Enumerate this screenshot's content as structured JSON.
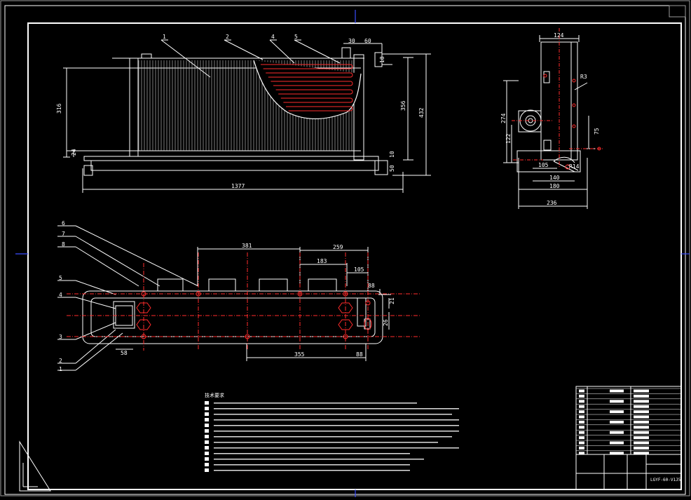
{
  "colors": {
    "background": "#000000",
    "frame": "#ffffff",
    "center_mark": "#3a4cff",
    "red": "#ff2b2b",
    "tile_white": "#ffffff",
    "gray_frame": "#9a9a9a"
  },
  "front_view": {
    "dim_left": "316",
    "dim_mid": "356",
    "dim_right": "432",
    "dim_bottom": "1377",
    "dim_top_a": "30",
    "dim_top_b": "60",
    "dim_top_c": "18",
    "dim_small_bottom": "24",
    "dim_foot_a": "50",
    "dim_foot_b": "10",
    "callouts": [
      "1",
      "2",
      "4",
      "5"
    ]
  },
  "side_view": {
    "dim_top": "124",
    "dim_left_a": "274",
    "dim_left_b": "122",
    "dim_right_a": "R3",
    "dim_right_b": "75",
    "dim_bottom_a": "105",
    "dim_bottom_r": "R14",
    "dim_bottom_b": "140",
    "dim_bottom_c": "180",
    "dim_bottom_d": "236"
  },
  "plan_view": {
    "dim_top_a": "381",
    "dim_top_b": "259",
    "dim_top_c": "183",
    "dim_top_d": "105",
    "dim_right_a": "88",
    "dim_right_b": "21",
    "dim_right_c": "26",
    "dim_bottom_a": "355",
    "dim_bottom_b": "58",
    "dim_bottom_c": "88",
    "callouts_left": [
      "6",
      "7",
      "8",
      "5",
      "4",
      "3",
      "2",
      "1"
    ]
  },
  "notes": {
    "heading": "技术要求"
  },
  "title_block": {
    "drawing_number": "LGYF-60-V1J5"
  }
}
